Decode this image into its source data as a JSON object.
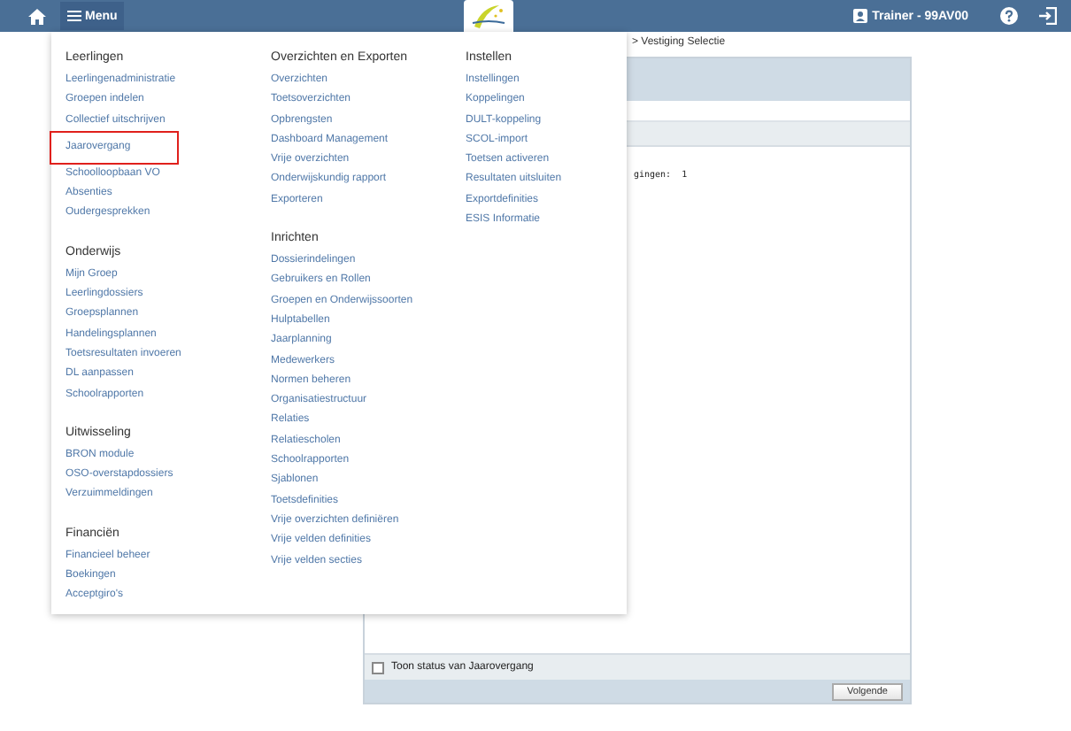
{
  "topbar": {
    "menu_label": "Menu",
    "user": "Trainer - 99AV00"
  },
  "breadcrumb": "> Vestiging Selectie",
  "panel": {
    "content_label": "gingen:",
    "content_value": "1",
    "checkbox": {
      "label": "Toon status van Jaarovergang",
      "checked": false
    },
    "next_button": "Volgende"
  },
  "menu": {
    "columns": [
      {
        "sections": [
          {
            "title": "Leerlingen",
            "items": [
              {
                "label": "Leerlingenadministratie",
                "highlighted": false
              },
              {
                "label": "Groepen indelen",
                "highlighted": false
              },
              {
                "label": "Collectief uitschrijven",
                "highlighted": false
              },
              {
                "label": "Jaarovergang",
                "highlighted": true
              },
              {
                "label": "Schoolloopbaan VO",
                "highlighted": false
              },
              {
                "label": "Absenties",
                "highlighted": false
              },
              {
                "label": "Oudergesprekken",
                "highlighted": false
              }
            ]
          },
          {
            "title": "Onderwijs",
            "items": [
              {
                "label": "Mijn Groep",
                "highlighted": false
              },
              {
                "label": "Leerlingdossiers",
                "highlighted": false
              },
              {
                "label": "Groepsplannen",
                "highlighted": false
              },
              {
                "label": "Handelingsplannen",
                "highlighted": false
              },
              {
                "label": "Toetsresultaten invoeren",
                "highlighted": false
              },
              {
                "label": "DL aanpassen",
                "highlighted": false
              },
              {
                "label": "Schoolrapporten",
                "highlighted": false
              }
            ]
          },
          {
            "title": "Uitwisseling",
            "items": [
              {
                "label": "BRON module",
                "highlighted": false
              },
              {
                "label": "OSO-overstapdossiers",
                "highlighted": false
              },
              {
                "label": "Verzuimmeldingen",
                "highlighted": false
              }
            ]
          },
          {
            "title": "Financiën",
            "items": [
              {
                "label": "Financieel beheer",
                "highlighted": false
              },
              {
                "label": "Boekingen",
                "highlighted": false
              },
              {
                "label": "Acceptgiro's",
                "highlighted": false
              }
            ]
          }
        ]
      },
      {
        "sections": [
          {
            "title": "Overzichten en Exporten",
            "items": [
              {
                "label": "Overzichten",
                "highlighted": false
              },
              {
                "label": "Toetsoverzichten",
                "highlighted": false
              },
              {
                "label": "Opbrengsten",
                "highlighted": false
              },
              {
                "label": "Dashboard Management",
                "highlighted": false
              },
              {
                "label": "Vrije overzichten",
                "highlighted": false
              },
              {
                "label": "Onderwijskundig rapport",
                "highlighted": false
              },
              {
                "label": "Exporteren",
                "highlighted": false
              }
            ]
          },
          {
            "title": "Inrichten",
            "items": [
              {
                "label": "Dossierindelingen",
                "highlighted": false
              },
              {
                "label": "Gebruikers en Rollen",
                "highlighted": false
              },
              {
                "label": "Groepen en Onderwijssoorten",
                "highlighted": false
              },
              {
                "label": "Hulptabellen",
                "highlighted": false
              },
              {
                "label": "Jaarplanning",
                "highlighted": false
              },
              {
                "label": "Medewerkers",
                "highlighted": false
              },
              {
                "label": "Normen beheren",
                "highlighted": false
              },
              {
                "label": "Organisatiestructuur",
                "highlighted": false
              },
              {
                "label": "Relaties",
                "highlighted": false
              },
              {
                "label": "Relatiescholen",
                "highlighted": false
              },
              {
                "label": "Schoolrapporten",
                "highlighted": false
              },
              {
                "label": "Sjablonen",
                "highlighted": false
              },
              {
                "label": "Toetsdefinities",
                "highlighted": false
              },
              {
                "label": "Vrije overzichten definiëren",
                "highlighted": false
              },
              {
                "label": "Vrije velden definities",
                "highlighted": false
              },
              {
                "label": "Vrije velden secties",
                "highlighted": false
              }
            ]
          }
        ]
      },
      {
        "sections": [
          {
            "title": "Instellen",
            "items": [
              {
                "label": "Instellingen",
                "highlighted": false
              },
              {
                "label": "Koppelingen",
                "highlighted": false
              },
              {
                "label": "DULT-koppeling",
                "highlighted": false
              },
              {
                "label": "SCOL-import",
                "highlighted": false
              },
              {
                "label": "Toetsen activeren",
                "highlighted": false
              },
              {
                "label": "Resultaten uitsluiten",
                "highlighted": false
              },
              {
                "label": "Exportdefinities",
                "highlighted": false
              },
              {
                "label": "ESIS Informatie",
                "highlighted": false
              }
            ]
          }
        ]
      }
    ]
  }
}
